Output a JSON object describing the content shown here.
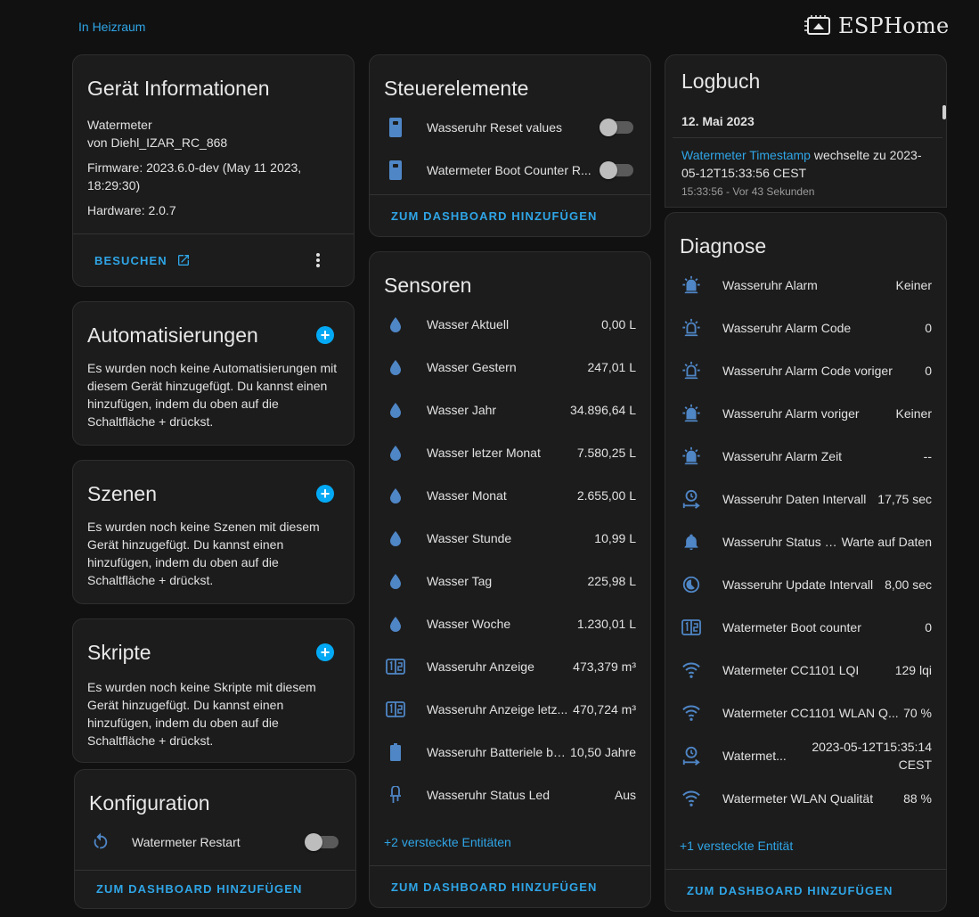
{
  "header": {
    "area_link": "In Heizraum",
    "logo_text": "ESPHome"
  },
  "device_info": {
    "title": "Gerät Informationen",
    "model": "Watermeter",
    "manufacturer": "von Diehl_IZAR_RC_868",
    "firmware": "Firmware: 2023.6.0-dev (May 11 2023, 18:29:30)",
    "hardware": "Hardware: 2.0.7",
    "visit_label": "BESUCHEN"
  },
  "automations": {
    "title": "Automatisierungen",
    "text": "Es wurden noch keine Automatisierungen mit diesem Gerät hinzugefügt. Du kannst einen hinzufügen, indem du oben auf die Schaltfläche + drückst."
  },
  "scenes": {
    "title": "Szenen",
    "text": "Es wurden noch keine Szenen mit diesem Gerät hinzugefügt. Du kannst einen hinzufügen, indem du oben auf die Schaltfläche + drückst."
  },
  "scripts": {
    "title": "Skripte",
    "text": "Es wurden noch keine Skripte mit diesem Gerät hinzugefügt. Du kannst einen hinzufügen, indem du oben auf die Schaltfläche + drückst."
  },
  "config": {
    "title": "Konfiguration",
    "items": [
      {
        "name": "Watermeter Restart",
        "icon": "restart-icon",
        "state": "off"
      }
    ],
    "action_label": "ZUM DASHBOARD HINZUFÜGEN"
  },
  "controls": {
    "title": "Steuerelemente",
    "items": [
      {
        "name": "Wasseruhr Reset values",
        "icon": "switch-device-icon",
        "state": "off"
      },
      {
        "name": "Watermeter Boot Counter R...",
        "icon": "switch-device-icon",
        "state": "off"
      }
    ],
    "action_label": "ZUM DASHBOARD HINZUFÜGEN"
  },
  "sensors": {
    "title": "Sensoren",
    "items": [
      {
        "name": "Wasser Aktuell",
        "value": "0,00 L",
        "icon": "water-drop-icon"
      },
      {
        "name": "Wasser Gestern",
        "value": "247,01 L",
        "icon": "water-drop-icon"
      },
      {
        "name": "Wasser Jahr",
        "value": "34.896,64 L",
        "icon": "water-drop-icon"
      },
      {
        "name": "Wasser letzer Monat",
        "value": "7.580,25 L",
        "icon": "water-drop-icon"
      },
      {
        "name": "Wasser Monat",
        "value": "2.655,00 L",
        "icon": "water-drop-icon"
      },
      {
        "name": "Wasser Stunde",
        "value": "10,99 L",
        "icon": "water-drop-icon"
      },
      {
        "name": "Wasser Tag",
        "value": "225,98 L",
        "icon": "water-drop-icon"
      },
      {
        "name": "Wasser Woche",
        "value": "1.230,01 L",
        "icon": "water-drop-icon"
      },
      {
        "name": "Wasseruhr Anzeige",
        "value": "473,379 m³",
        "icon": "counter-icon"
      },
      {
        "name": "Wasseruhr Anzeige letz...",
        "value": "470,724 m³",
        "icon": "counter-icon"
      },
      {
        "name": "Wasseruhr Batteriele be...",
        "value": "10,50 Jahre",
        "icon": "battery-icon"
      },
      {
        "name": "Wasseruhr Status Led",
        "value": "Aus",
        "icon": "led-icon"
      }
    ],
    "hidden_link": "+2 versteckte Entitäten",
    "action_label": "ZUM DASHBOARD HINZUFÜGEN"
  },
  "logbook": {
    "title": "Logbuch",
    "date": "12. Mai 2023",
    "entity": "Watermeter Timestamp",
    "message": " wechselte zu 2023-05-12T15:33:56 CEST",
    "time": "15:33:56 - Vor 43 Sekunden"
  },
  "diagnostics": {
    "title": "Diagnose",
    "items": [
      {
        "name": "Wasseruhr Alarm",
        "value": "Keiner",
        "icon": "alarm-light-icon"
      },
      {
        "name": "Wasseruhr Alarm Code",
        "value": "0",
        "icon": "alarm-light-outline-icon"
      },
      {
        "name": "Wasseruhr Alarm Code voriger",
        "value": "0",
        "icon": "alarm-light-outline-icon"
      },
      {
        "name": "Wasseruhr Alarm voriger",
        "value": "Keiner",
        "icon": "alarm-light-icon"
      },
      {
        "name": "Wasseruhr Alarm Zeit",
        "value": "--",
        "icon": "alarm-light-icon"
      },
      {
        "name": "Wasseruhr Daten Intervall",
        "value": "17,75 sec",
        "icon": "clock-arrow-icon"
      },
      {
        "name": "Wasseruhr Status I...",
        "value": "Warte auf Daten",
        "icon": "bell-icon"
      },
      {
        "name": "Wasseruhr Update Intervall",
        "value": "8,00 sec",
        "icon": "timelapse-icon"
      },
      {
        "name": "Watermeter Boot counter",
        "value": "0",
        "icon": "counter-icon"
      },
      {
        "name": "Watermeter CC1101 LQI",
        "value": "129 lqi",
        "icon": "wifi-icon"
      },
      {
        "name": "Watermeter CC1101 WLAN Q...",
        "value": "70 %",
        "icon": "wifi-icon"
      },
      {
        "name": "Watermet...",
        "value": "2023-05-12T15:35:14 CEST",
        "icon": "clock-arrow-icon"
      },
      {
        "name": "Watermeter WLAN Qualität",
        "value": "88 %",
        "icon": "wifi-icon"
      }
    ],
    "hidden_link": "+1 versteckte Entität",
    "action_label": "ZUM DASHBOARD HINZUFÜGEN"
  },
  "colors": {
    "accent": "#2fa5e6",
    "icon": "#4f86c6",
    "card": "#1c1c1c",
    "background": "#111111"
  }
}
